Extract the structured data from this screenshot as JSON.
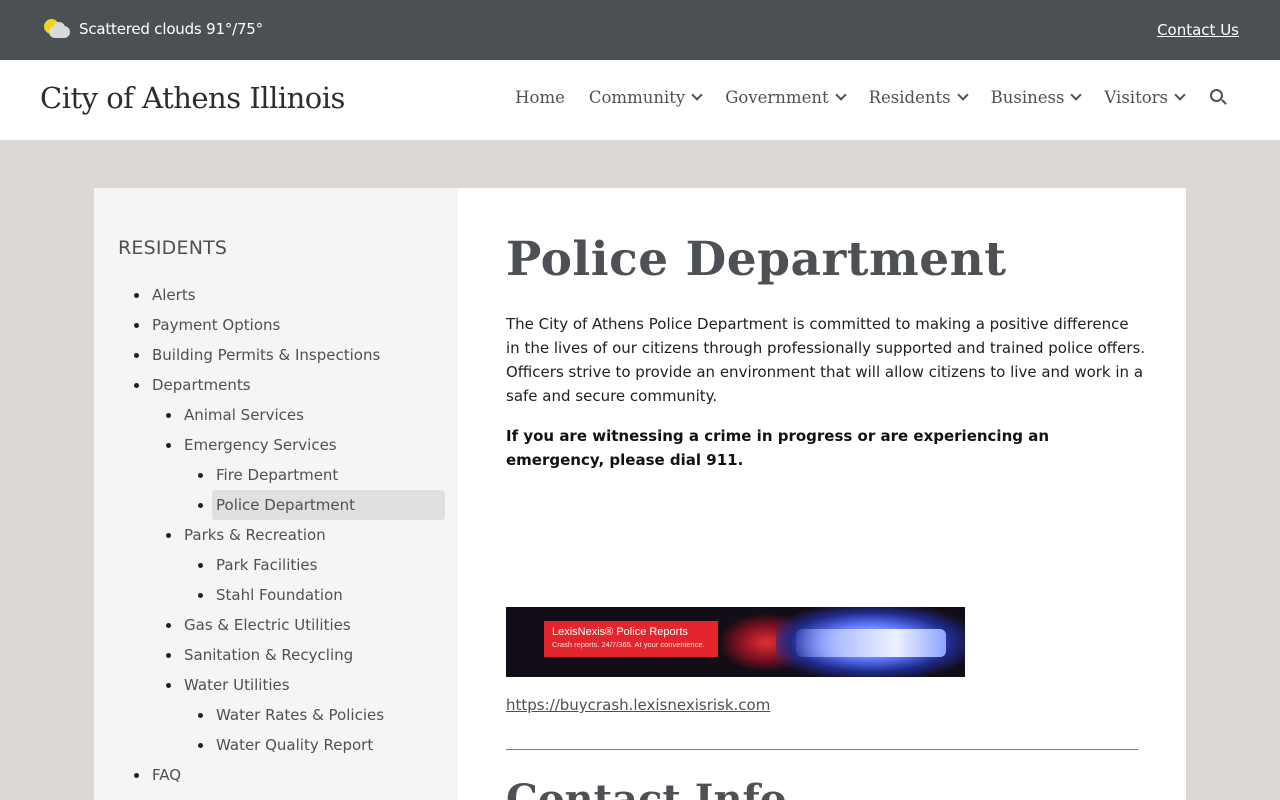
{
  "topbar": {
    "weather_icon": "partly-cloudy-icon",
    "weather_text": "Scattered clouds 91°/75°",
    "contact_label": "Contact Us"
  },
  "header": {
    "site_title": "City of Athens Illinois",
    "nav": [
      {
        "label": "Home",
        "dropdown": false
      },
      {
        "label": "Community",
        "dropdown": true
      },
      {
        "label": "Government",
        "dropdown": true
      },
      {
        "label": "Residents",
        "dropdown": true
      },
      {
        "label": "Business",
        "dropdown": true
      },
      {
        "label": "Visitors",
        "dropdown": true
      }
    ],
    "search_icon": "search-icon"
  },
  "sidebar": {
    "heading": "RESIDENTS",
    "items": [
      {
        "label": "Alerts",
        "level": 1
      },
      {
        "label": "Payment Options",
        "level": 1
      },
      {
        "label": "Building Permits & Inspections",
        "level": 1
      },
      {
        "label": "Departments",
        "level": 1
      },
      {
        "label": "Animal Services",
        "level": 2
      },
      {
        "label": "Emergency Services",
        "level": 2
      },
      {
        "label": "Fire Department",
        "level": 3
      },
      {
        "label": "Police Department",
        "level": 3,
        "active": true
      },
      {
        "label": "Parks & Recreation",
        "level": 2
      },
      {
        "label": "Park Facilities",
        "level": 3
      },
      {
        "label": "Stahl Foundation",
        "level": 3
      },
      {
        "label": "Gas & Electric Utilities",
        "level": 2
      },
      {
        "label": "Sanitation & Recycling",
        "level": 2
      },
      {
        "label": "Water Utilities",
        "level": 2
      },
      {
        "label": "Water Rates & Policies",
        "level": 3
      },
      {
        "label": "Water Quality Report",
        "level": 3
      },
      {
        "label": "FAQ",
        "level": 1
      }
    ]
  },
  "main": {
    "title": "Police Department",
    "intro": "The City of Athens Police Department is committed to making a positive difference in the lives of our citizens through professionally supported and trained police offers. Officers strive to provide an environment that will allow citizens to live and work in a safe and secure community.",
    "emergency": "If you are witnessing a crime in progress or are experiencing an emergency, please dial 911.",
    "banner_title": "LexisNexis® Police Reports",
    "banner_subtitle": "Crash reports. 24/7/365. At your convenience.",
    "crash_link": "https://buycrash.lexisnexisrisk.com",
    "contact_heading": "Contact Info"
  },
  "colors": {
    "topbar_bg": "#4b5054",
    "page_bg": "#dcd8d3",
    "sidebar_bg": "#f5f5f5",
    "text_gray": "#4d5155",
    "banner_red": "#e3262d"
  }
}
